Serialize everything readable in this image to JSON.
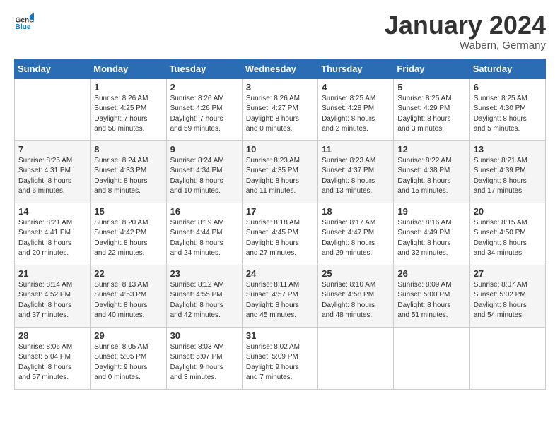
{
  "logo": {
    "general": "General",
    "blue": "Blue"
  },
  "title": "January 2024",
  "location": "Wabern, Germany",
  "weekdays": [
    "Sunday",
    "Monday",
    "Tuesday",
    "Wednesday",
    "Thursday",
    "Friday",
    "Saturday"
  ],
  "weeks": [
    [
      {
        "day": null,
        "info": null
      },
      {
        "day": "1",
        "info": "Sunrise: 8:26 AM\nSunset: 4:25 PM\nDaylight: 7 hours\nand 58 minutes."
      },
      {
        "day": "2",
        "info": "Sunrise: 8:26 AM\nSunset: 4:26 PM\nDaylight: 7 hours\nand 59 minutes."
      },
      {
        "day": "3",
        "info": "Sunrise: 8:26 AM\nSunset: 4:27 PM\nDaylight: 8 hours\nand 0 minutes."
      },
      {
        "day": "4",
        "info": "Sunrise: 8:25 AM\nSunset: 4:28 PM\nDaylight: 8 hours\nand 2 minutes."
      },
      {
        "day": "5",
        "info": "Sunrise: 8:25 AM\nSunset: 4:29 PM\nDaylight: 8 hours\nand 3 minutes."
      },
      {
        "day": "6",
        "info": "Sunrise: 8:25 AM\nSunset: 4:30 PM\nDaylight: 8 hours\nand 5 minutes."
      }
    ],
    [
      {
        "day": "7",
        "info": "Sunrise: 8:25 AM\nSunset: 4:31 PM\nDaylight: 8 hours\nand 6 minutes."
      },
      {
        "day": "8",
        "info": "Sunrise: 8:24 AM\nSunset: 4:33 PM\nDaylight: 8 hours\nand 8 minutes."
      },
      {
        "day": "9",
        "info": "Sunrise: 8:24 AM\nSunset: 4:34 PM\nDaylight: 8 hours\nand 10 minutes."
      },
      {
        "day": "10",
        "info": "Sunrise: 8:23 AM\nSunset: 4:35 PM\nDaylight: 8 hours\nand 11 minutes."
      },
      {
        "day": "11",
        "info": "Sunrise: 8:23 AM\nSunset: 4:37 PM\nDaylight: 8 hours\nand 13 minutes."
      },
      {
        "day": "12",
        "info": "Sunrise: 8:22 AM\nSunset: 4:38 PM\nDaylight: 8 hours\nand 15 minutes."
      },
      {
        "day": "13",
        "info": "Sunrise: 8:21 AM\nSunset: 4:39 PM\nDaylight: 8 hours\nand 17 minutes."
      }
    ],
    [
      {
        "day": "14",
        "info": "Sunrise: 8:21 AM\nSunset: 4:41 PM\nDaylight: 8 hours\nand 20 minutes."
      },
      {
        "day": "15",
        "info": "Sunrise: 8:20 AM\nSunset: 4:42 PM\nDaylight: 8 hours\nand 22 minutes."
      },
      {
        "day": "16",
        "info": "Sunrise: 8:19 AM\nSunset: 4:44 PM\nDaylight: 8 hours\nand 24 minutes."
      },
      {
        "day": "17",
        "info": "Sunrise: 8:18 AM\nSunset: 4:45 PM\nDaylight: 8 hours\nand 27 minutes."
      },
      {
        "day": "18",
        "info": "Sunrise: 8:17 AM\nSunset: 4:47 PM\nDaylight: 8 hours\nand 29 minutes."
      },
      {
        "day": "19",
        "info": "Sunrise: 8:16 AM\nSunset: 4:49 PM\nDaylight: 8 hours\nand 32 minutes."
      },
      {
        "day": "20",
        "info": "Sunrise: 8:15 AM\nSunset: 4:50 PM\nDaylight: 8 hours\nand 34 minutes."
      }
    ],
    [
      {
        "day": "21",
        "info": "Sunrise: 8:14 AM\nSunset: 4:52 PM\nDaylight: 8 hours\nand 37 minutes."
      },
      {
        "day": "22",
        "info": "Sunrise: 8:13 AM\nSunset: 4:53 PM\nDaylight: 8 hours\nand 40 minutes."
      },
      {
        "day": "23",
        "info": "Sunrise: 8:12 AM\nSunset: 4:55 PM\nDaylight: 8 hours\nand 42 minutes."
      },
      {
        "day": "24",
        "info": "Sunrise: 8:11 AM\nSunset: 4:57 PM\nDaylight: 8 hours\nand 45 minutes."
      },
      {
        "day": "25",
        "info": "Sunrise: 8:10 AM\nSunset: 4:58 PM\nDaylight: 8 hours\nand 48 minutes."
      },
      {
        "day": "26",
        "info": "Sunrise: 8:09 AM\nSunset: 5:00 PM\nDaylight: 8 hours\nand 51 minutes."
      },
      {
        "day": "27",
        "info": "Sunrise: 8:07 AM\nSunset: 5:02 PM\nDaylight: 8 hours\nand 54 minutes."
      }
    ],
    [
      {
        "day": "28",
        "info": "Sunrise: 8:06 AM\nSunset: 5:04 PM\nDaylight: 8 hours\nand 57 minutes."
      },
      {
        "day": "29",
        "info": "Sunrise: 8:05 AM\nSunset: 5:05 PM\nDaylight: 9 hours\nand 0 minutes."
      },
      {
        "day": "30",
        "info": "Sunrise: 8:03 AM\nSunset: 5:07 PM\nDaylight: 9 hours\nand 3 minutes."
      },
      {
        "day": "31",
        "info": "Sunrise: 8:02 AM\nSunset: 5:09 PM\nDaylight: 9 hours\nand 7 minutes."
      },
      {
        "day": null,
        "info": null
      },
      {
        "day": null,
        "info": null
      },
      {
        "day": null,
        "info": null
      }
    ]
  ]
}
